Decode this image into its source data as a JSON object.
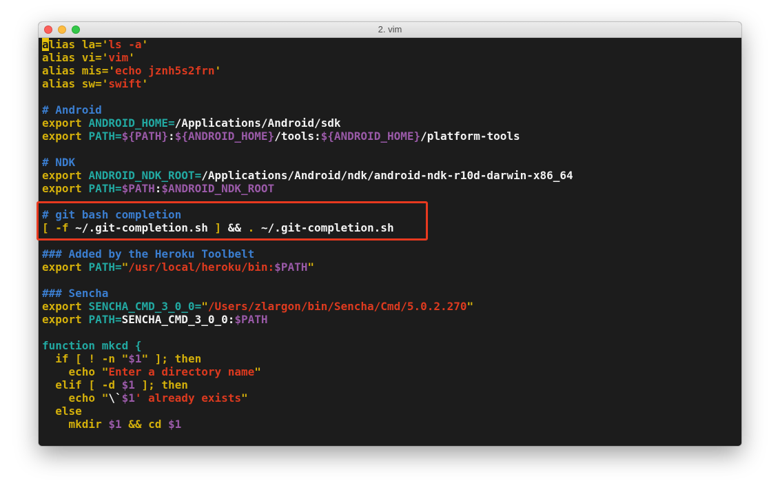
{
  "window": {
    "title": "2. vim"
  },
  "colors": {
    "terminal_background": "#1c1c1c",
    "keyword": "#d4b00b",
    "string": "#dd3a1f",
    "comment": "#3b7ed0",
    "variable": "#9a5aa8",
    "identifier": "#22a9a2",
    "plain": "#f2f2f2",
    "cursor": "#e5c00a",
    "highlight_box": "#e8391f"
  },
  "editor": {
    "lines": [
      [
        {
          "text": "a",
          "color": "cursor",
          "cursor": true
        },
        {
          "text": "lias la=",
          "color": "keyword"
        },
        {
          "text": "'",
          "color": "keyword"
        },
        {
          "text": "ls -a",
          "color": "string"
        },
        {
          "text": "'",
          "color": "keyword"
        }
      ],
      [
        {
          "text": "alias vi=",
          "color": "keyword"
        },
        {
          "text": "'",
          "color": "keyword"
        },
        {
          "text": "vim",
          "color": "string"
        },
        {
          "text": "'",
          "color": "keyword"
        }
      ],
      [
        {
          "text": "alias mis=",
          "color": "keyword"
        },
        {
          "text": "'",
          "color": "keyword"
        },
        {
          "text": "echo jznh5s2frn",
          "color": "string"
        },
        {
          "text": "'",
          "color": "keyword"
        }
      ],
      [
        {
          "text": "alias sw=",
          "color": "keyword"
        },
        {
          "text": "'",
          "color": "keyword"
        },
        {
          "text": "swift",
          "color": "string"
        },
        {
          "text": "'",
          "color": "keyword"
        }
      ],
      [],
      [
        {
          "text": "# Android",
          "color": "comment"
        }
      ],
      [
        {
          "text": "export ",
          "color": "keyword"
        },
        {
          "text": "ANDROID_HOME=",
          "color": "identifier"
        },
        {
          "text": "/Applications/Android/sdk",
          "color": "plain"
        }
      ],
      [
        {
          "text": "export ",
          "color": "keyword"
        },
        {
          "text": "PATH=",
          "color": "identifier"
        },
        {
          "text": "${PATH}",
          "color": "variable"
        },
        {
          "text": ":",
          "color": "plain"
        },
        {
          "text": "${ANDROID_HOME}",
          "color": "variable"
        },
        {
          "text": "/tools:",
          "color": "plain"
        },
        {
          "text": "${ANDROID_HOME}",
          "color": "variable"
        },
        {
          "text": "/platform-tools",
          "color": "plain"
        }
      ],
      [],
      [
        {
          "text": "# NDK",
          "color": "comment"
        }
      ],
      [
        {
          "text": "export ",
          "color": "keyword"
        },
        {
          "text": "ANDROID_NDK_ROOT=",
          "color": "identifier"
        },
        {
          "text": "/Applications/Android/ndk/android-ndk-r10d-darwin-x86_64",
          "color": "plain"
        }
      ],
      [
        {
          "text": "export ",
          "color": "keyword"
        },
        {
          "text": "PATH=",
          "color": "identifier"
        },
        {
          "text": "$PATH",
          "color": "variable"
        },
        {
          "text": ":",
          "color": "plain"
        },
        {
          "text": "$ANDROID_NDK_ROOT",
          "color": "variable"
        }
      ],
      [],
      [
        {
          "text": "# git bash completion",
          "color": "comment"
        }
      ],
      [
        {
          "text": "[ -f ",
          "color": "keyword"
        },
        {
          "text": "~/.git-completion.sh ",
          "color": "plain"
        },
        {
          "text": "]",
          "color": "keyword"
        },
        {
          "text": " && ",
          "color": "plain"
        },
        {
          "text": ".",
          "color": "keyword"
        },
        {
          "text": " ~/.git-completion.sh",
          "color": "plain"
        }
      ],
      [],
      [
        {
          "text": "### Added by the Heroku Toolbelt",
          "color": "comment"
        }
      ],
      [
        {
          "text": "export ",
          "color": "keyword"
        },
        {
          "text": "PATH=",
          "color": "identifier"
        },
        {
          "text": "\"",
          "color": "keyword"
        },
        {
          "text": "/usr/local/heroku/bin:",
          "color": "string"
        },
        {
          "text": "$PATH",
          "color": "variable"
        },
        {
          "text": "\"",
          "color": "keyword"
        }
      ],
      [],
      [
        {
          "text": "### Sencha",
          "color": "comment"
        }
      ],
      [
        {
          "text": "export ",
          "color": "keyword"
        },
        {
          "text": "SENCHA_CMD_3_0_0=",
          "color": "identifier"
        },
        {
          "text": "\"",
          "color": "keyword"
        },
        {
          "text": "/Users/zlargon/bin/Sencha/Cmd/5.0.2.270",
          "color": "string"
        },
        {
          "text": "\"",
          "color": "keyword"
        }
      ],
      [
        {
          "text": "export ",
          "color": "keyword"
        },
        {
          "text": "PATH=",
          "color": "identifier"
        },
        {
          "text": "SENCHA_CMD_3_0_0:",
          "color": "plain"
        },
        {
          "text": "$PATH",
          "color": "variable"
        }
      ],
      [],
      [
        {
          "text": "function mkcd {",
          "color": "identifier"
        }
      ],
      [
        {
          "text": "  if [ ! -n ",
          "color": "keyword"
        },
        {
          "text": "\"",
          "color": "keyword"
        },
        {
          "text": "$1",
          "color": "variable"
        },
        {
          "text": "\"",
          "color": "keyword"
        },
        {
          "text": " ]; then",
          "color": "keyword"
        }
      ],
      [
        {
          "text": "    echo ",
          "color": "keyword"
        },
        {
          "text": "\"",
          "color": "keyword"
        },
        {
          "text": "Enter a directory name",
          "color": "string"
        },
        {
          "text": "\"",
          "color": "keyword"
        }
      ],
      [
        {
          "text": "  elif [ -d ",
          "color": "keyword"
        },
        {
          "text": "$1",
          "color": "variable"
        },
        {
          "text": " ]; then",
          "color": "keyword"
        }
      ],
      [
        {
          "text": "    echo ",
          "color": "keyword"
        },
        {
          "text": "\"",
          "color": "keyword"
        },
        {
          "text": "\\`",
          "color": "plain"
        },
        {
          "text": "$1",
          "color": "variable"
        },
        {
          "text": "' already exists",
          "color": "string"
        },
        {
          "text": "\"",
          "color": "keyword"
        }
      ],
      [
        {
          "text": "  else",
          "color": "keyword"
        }
      ],
      [
        {
          "text": "    mkdir ",
          "color": "keyword"
        },
        {
          "text": "$1",
          "color": "variable"
        },
        {
          "text": " && cd ",
          "color": "keyword"
        },
        {
          "text": "$1",
          "color": "variable"
        }
      ]
    ]
  }
}
